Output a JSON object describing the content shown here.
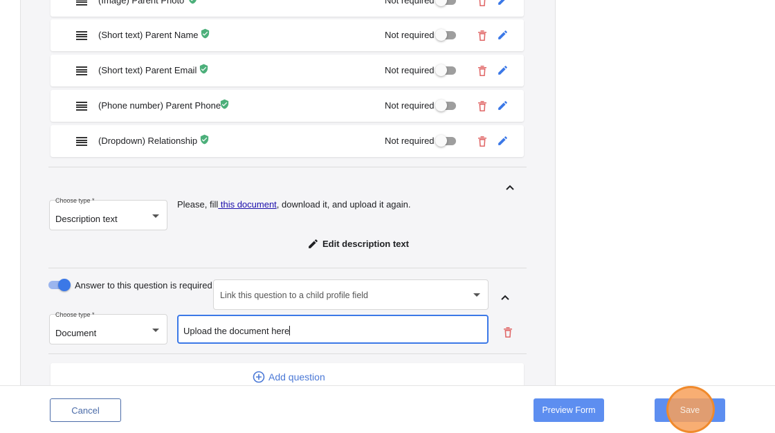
{
  "questions": [
    {
      "label": "(Image) Parent Photo",
      "required_text": "Not required"
    },
    {
      "label": "(Short text) Parent Name",
      "required_text": "Not required"
    },
    {
      "label": "(Short text) Parent Email",
      "required_text": "Not required"
    },
    {
      "label": "(Phone number) Parent Phone",
      "required_text": "Not required"
    },
    {
      "label": "(Dropdown) Relationship",
      "required_text": "Not required"
    }
  ],
  "description_block": {
    "type_label": "Choose type *",
    "type_value": "Description text",
    "text_before": "Please, fill",
    "link_text": " this document",
    "text_after": ", download it, and upload it again.",
    "edit_label": "Edit description text"
  },
  "document_block": {
    "required_label": "Answer to this question is required.",
    "link_placeholder": "Link this question to a child profile field",
    "type_label": "Choose type *",
    "type_value": "Document",
    "input_value": "Upload the document here"
  },
  "add_question_label": "Add question",
  "footer": {
    "cancel_label": "Cancel",
    "preview_label": "Preview Form",
    "save_label": "Save"
  },
  "colors": {
    "accent": "#5d8ef0",
    "danger": "#e06666",
    "edit": "#3b78e7",
    "verified": "#4caf7a",
    "click_highlight": "#f08a2c"
  }
}
